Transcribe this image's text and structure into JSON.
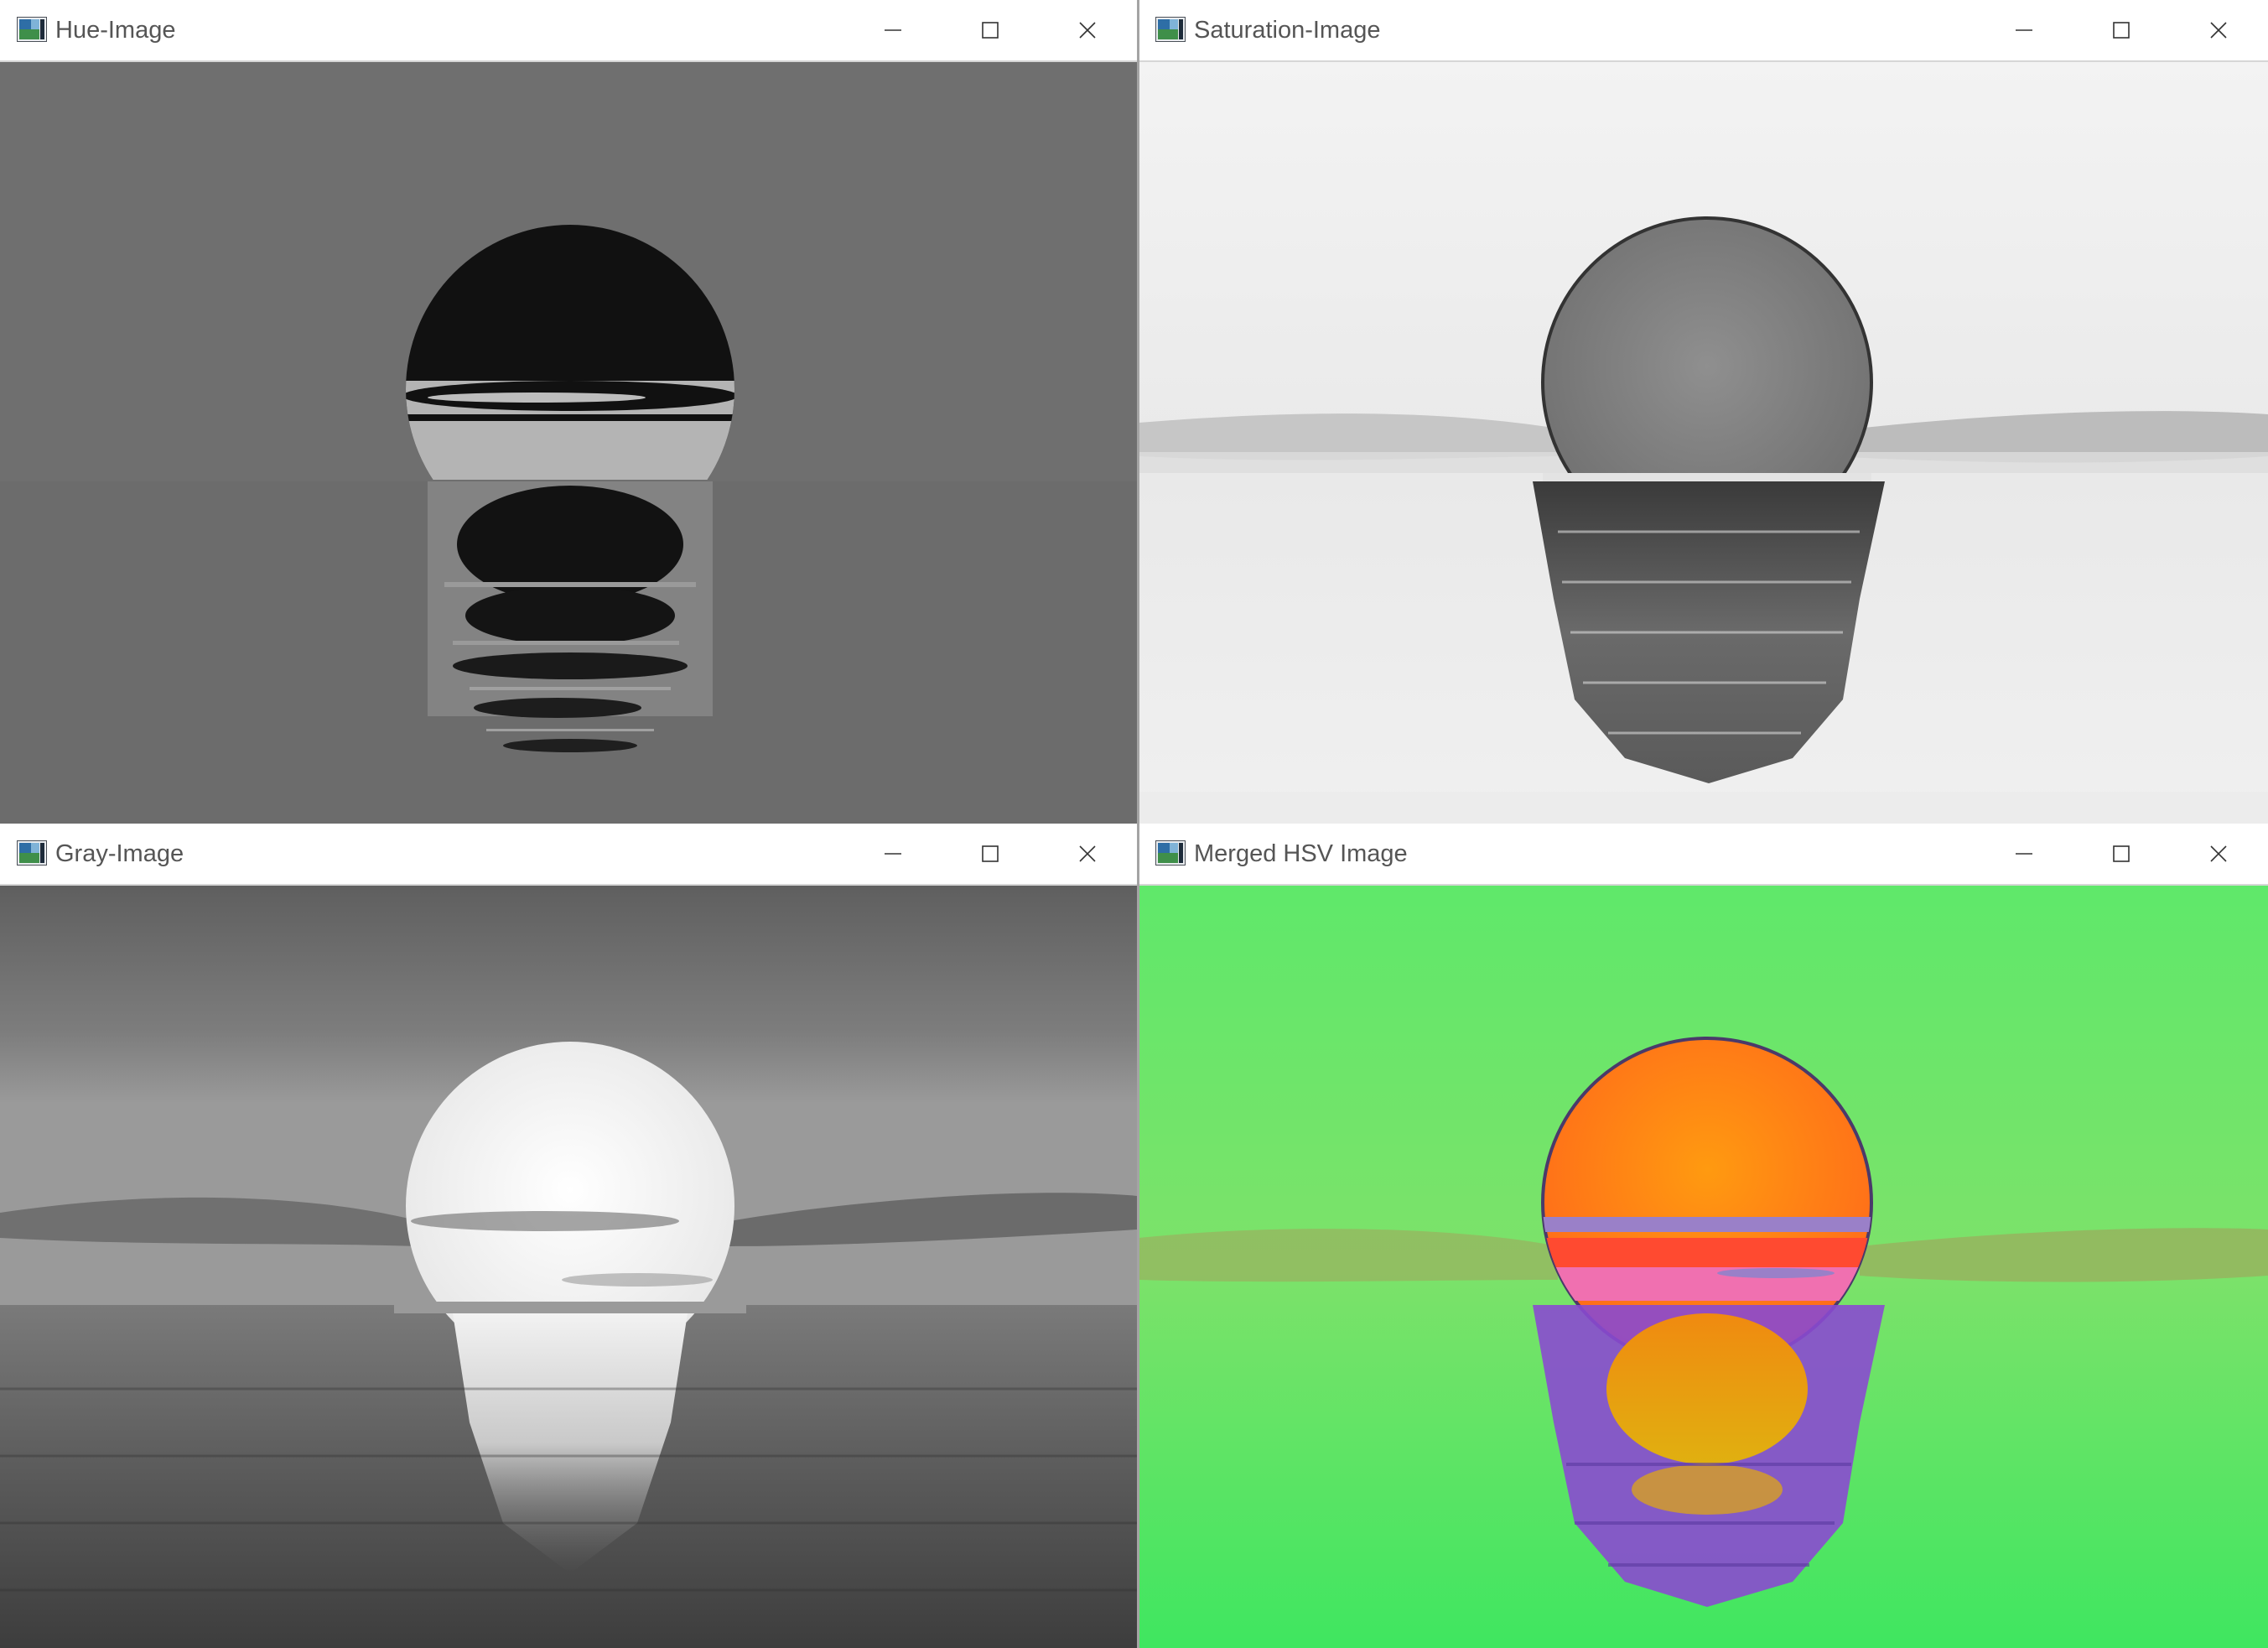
{
  "windows": {
    "hue": {
      "title": "Hue-Image"
    },
    "saturation": {
      "title": "Saturation-Image"
    },
    "gray": {
      "title": "Gray-Image"
    },
    "merged": {
      "title": "Merged HSV Image"
    }
  },
  "controls": {
    "minimize_icon": "minimize-icon",
    "maximize_icon": "maximize-icon",
    "close_icon": "close-icon"
  },
  "colors": {
    "hue_background": "#6f6f6f",
    "saturation_background": "#ededed",
    "merged_background": "#66ea66",
    "sun_orange": "#ff7a1a"
  }
}
